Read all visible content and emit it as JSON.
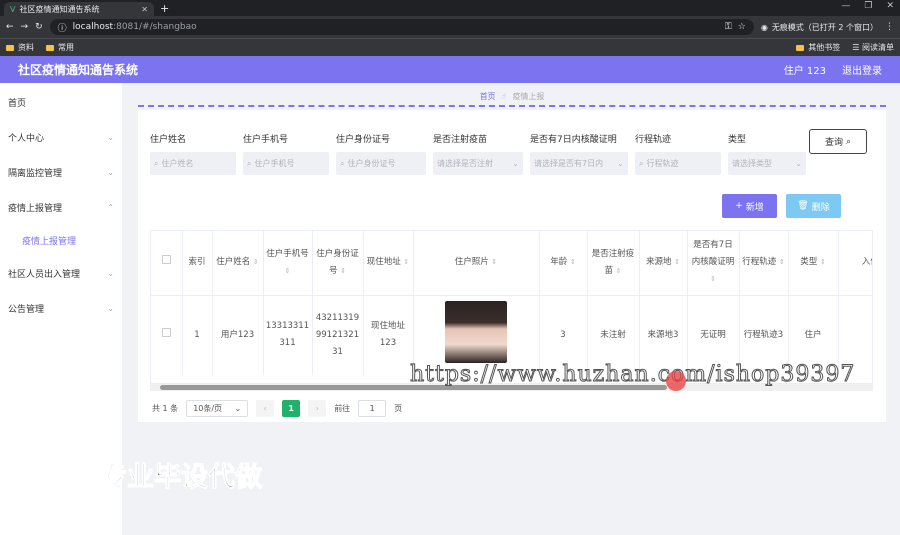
{
  "browser": {
    "tab_title": "社区疫情通知通告系统",
    "url_host": "localhost",
    "url_rest": ":8081/#/shangbao",
    "incognito": "无痕模式（已打开 2 个窗口）",
    "bookmarks": [
      "资料",
      "常用"
    ],
    "bookmarks_right": [
      "其他书签",
      "阅读清单"
    ]
  },
  "header": {
    "title": "社区疫情通知通告系统",
    "user": "住户 123",
    "logout": "退出登录",
    "color": "#7b73f0"
  },
  "sidebar": {
    "items": [
      {
        "label": "首页",
        "arrow": ""
      },
      {
        "label": "个人中心",
        "arrow": "⌄"
      },
      {
        "label": "隔离监控管理",
        "arrow": "⌄"
      },
      {
        "label": "疫情上报管理",
        "arrow": "⌃"
      },
      {
        "label": "疫情上报管理",
        "arrow": ""
      },
      {
        "label": "社区人员出入管理",
        "arrow": "⌄"
      },
      {
        "label": "公告管理",
        "arrow": "⌄"
      }
    ]
  },
  "breadcrumb": {
    "home": "首页",
    "current": "疫情上报"
  },
  "filters": [
    {
      "label": "住户姓名",
      "placeholder": "住户姓名"
    },
    {
      "label": "住户手机号",
      "placeholder": "住户手机号"
    },
    {
      "label": "住户身份证号",
      "placeholder": "住户身份证号"
    },
    {
      "label": "是否注射疫苗",
      "placeholder": "请选择是否注射"
    },
    {
      "label": "是否有7日内核酸证明",
      "placeholder": "请选择是否有7日内"
    },
    {
      "label": "行程轨迹",
      "placeholder": "行程轨迹"
    },
    {
      "label": "类型",
      "placeholder": "请选择类型"
    }
  ],
  "query_label": "查询",
  "add_label": "新增",
  "delete_label": "删除",
  "table": {
    "headers": [
      "索引",
      "住户姓名",
      "住户手机号",
      "住户身份证号",
      "现住地址",
      "住户照片",
      "年龄",
      "是否注射疫苗",
      "来源地",
      "是否有7日内核酸证明",
      "行程轨迹",
      "类型",
      "入住时"
    ],
    "rows": [
      [
        "1",
        "用户123",
        "13313311311",
        "432113199912132131",
        "现住地址123",
        "",
        "3",
        "未注射",
        "来源地3",
        "无证明",
        "行程轨迹3",
        "住户",
        ""
      ]
    ]
  },
  "pager": {
    "total": "共 1 条",
    "size": "10条/页",
    "page": "1",
    "goto": "前往",
    "goto_val": "1",
    "unit": "页"
  },
  "watermark": "https://www.huzhan.com/ishop39397",
  "promo": "专业毕设代做"
}
